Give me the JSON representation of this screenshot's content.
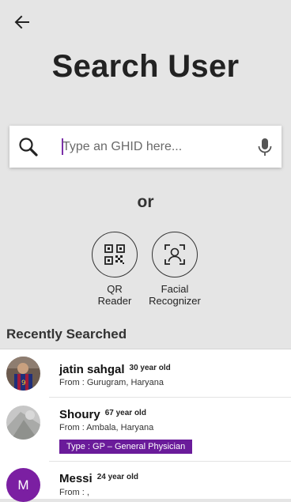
{
  "header": {
    "title": "Search User"
  },
  "search": {
    "placeholder": "Type an GHID here..."
  },
  "or_label": "or",
  "options": [
    {
      "label_line1": "QR",
      "label_line2": "Reader",
      "icon": "qr-code-icon"
    },
    {
      "label_line1": "Facial",
      "label_line2": "Recognizer",
      "icon": "face-scan-icon"
    }
  ],
  "recent": {
    "title": "Recently Searched",
    "users": [
      {
        "name": "jatin sahgal",
        "age": "30 year old",
        "from": "From : Gurugram, Haryana"
      },
      {
        "name": "Shoury",
        "age": "67 year old",
        "from": "From : Ambala, Haryana",
        "type": "Type : GP – General Physician"
      },
      {
        "name": "Messi",
        "age": "24 year old",
        "from": "From : ,",
        "initial": "M"
      }
    ]
  },
  "colors": {
    "accent": "#6a1b9a",
    "background": "#e5e5e5",
    "avatar_purple": "#7b1fa2"
  }
}
